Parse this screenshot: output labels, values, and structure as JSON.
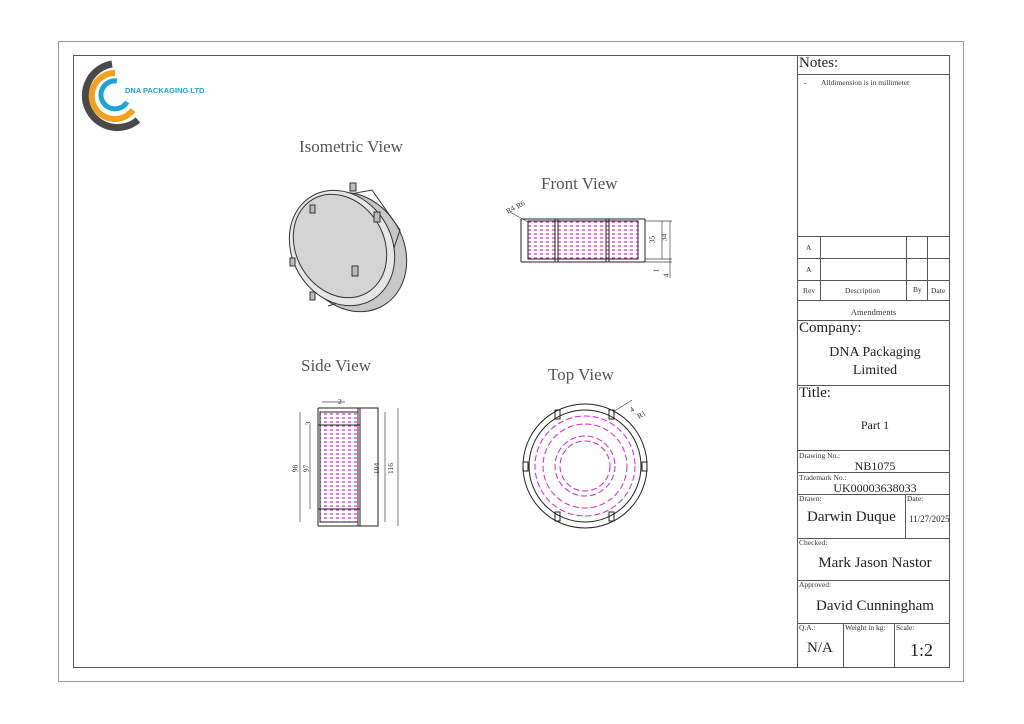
{
  "logo": {
    "company_short": "DNA PACKAGING LTD"
  },
  "views": {
    "isometric": "Isometric View",
    "front": "Front View",
    "side": "Side View",
    "top": "Top View"
  },
  "dimensions": {
    "front": {
      "r4": "R4",
      "r6": "R6",
      "h35": "35",
      "h34": "34",
      "d1": "1",
      "d4": "4"
    },
    "side": {
      "d2": "2",
      "d3": "3",
      "d98": "98",
      "d97": "97",
      "d104": "104",
      "d116": "116"
    },
    "top": {
      "d4": "4",
      "r1": "R1"
    }
  },
  "title_block": {
    "notes_label": "Notes:",
    "notes": [
      "-",
      "Alldimension is in millimeter"
    ],
    "rev_rows": [
      {
        "rev": "A",
        "description": "",
        "by": "",
        "date": ""
      },
      {
        "rev": "A",
        "description": "",
        "by": "",
        "date": ""
      }
    ],
    "rev_header": {
      "rev": "Rev",
      "description": "Description",
      "by": "By",
      "date": "Date"
    },
    "amendments": "Amendments",
    "company_label": "Company:",
    "company_line1": "DNA Packaging",
    "company_line2": "Limited",
    "title_label": "Title:",
    "title_value": "Part 1",
    "drawing_no_label": "Drawing No.:",
    "drawing_no": "NB1075",
    "trademark_label": "Trademark No.:",
    "trademark_no": "UK00003638033",
    "drawn_label": "Drawn:",
    "drawn_by": "Darwin Duque",
    "date_label": "Date:",
    "date": "11/27/2025",
    "checked_label": "Checked:",
    "checked_by": "Mark Jason Nastor",
    "approved_label": "Approved:",
    "approved_by": "David Cunningham",
    "qa_label": "Q.A.:",
    "qa": "N/A",
    "weight_label": "Weight in kg:",
    "weight": "",
    "scale_label": "Scale:",
    "scale": "1:2"
  },
  "colors": {
    "hatch": "#e020d0",
    "line": "#222222",
    "logo_blue": "#1aa3d9",
    "logo_orange": "#f2a11e",
    "logo_gray": "#4a4a4a"
  }
}
